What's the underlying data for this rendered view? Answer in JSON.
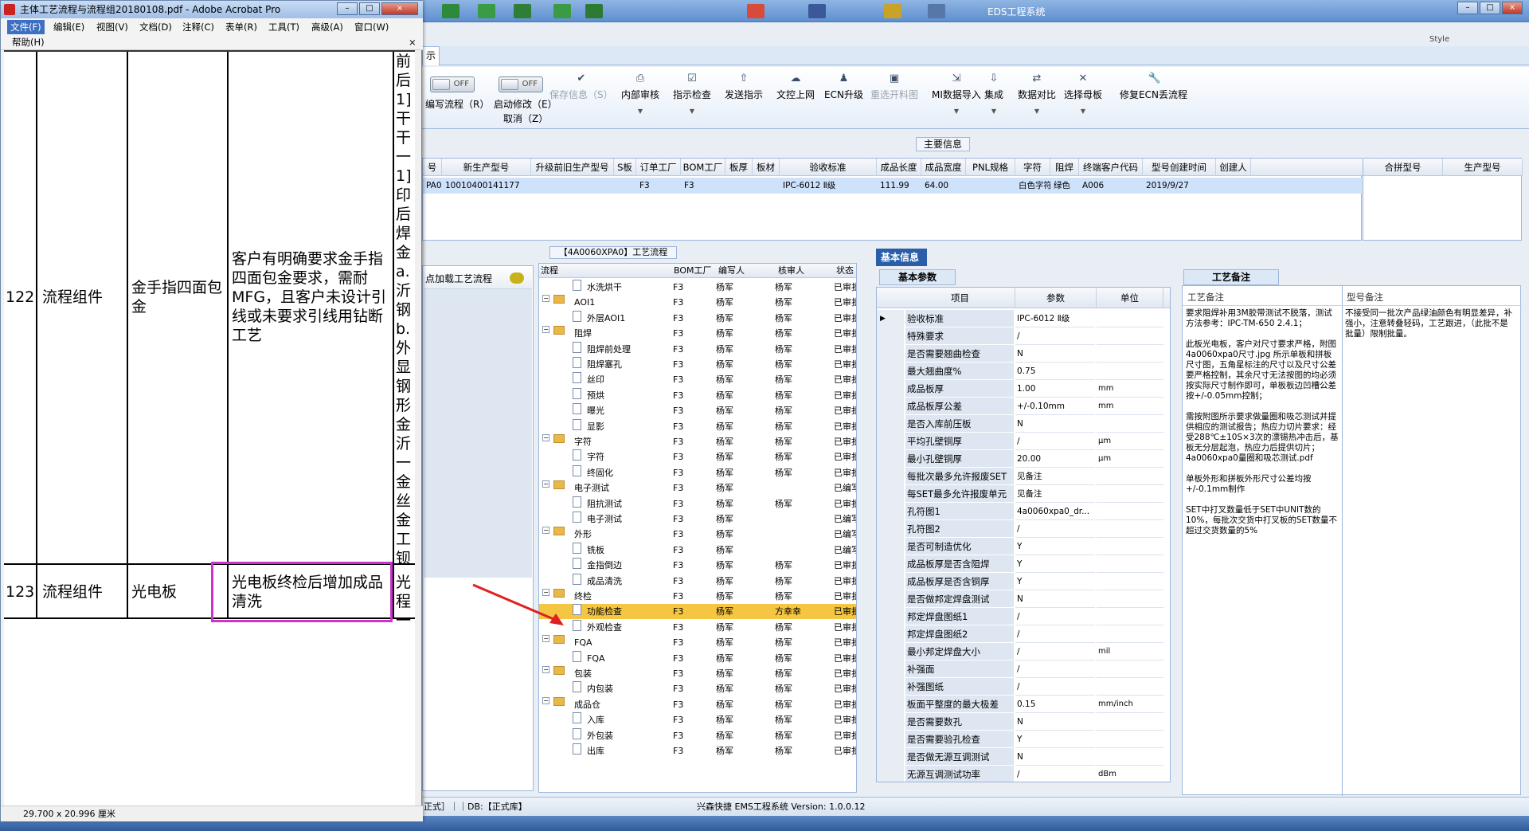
{
  "eds": {
    "title": "EDS工程系统",
    "style_label": "Style",
    "tab_label": "示",
    "toggles": [
      {
        "state": "OFF",
        "label": "编写流程（R）"
      },
      {
        "state": "OFF",
        "label": "启动修改（E）",
        "sub": "取消（Z）"
      }
    ],
    "ribbon": [
      {
        "label": "保存信息（S）",
        "icon": "check-icon",
        "disabled": true,
        "dropdown": false
      },
      {
        "label": "内部审核",
        "icon": "printer-icon",
        "disabled": false,
        "dropdown": true
      },
      {
        "label": "指示检查",
        "icon": "checkbox-icon",
        "disabled": false,
        "dropdown": true
      },
      {
        "label": "发送指示",
        "icon": "upload-icon",
        "disabled": false,
        "dropdown": false
      },
      {
        "label": "文控上网",
        "icon": "cloud-icon",
        "disabled": false,
        "dropdown": false
      },
      {
        "label": "ECN升级",
        "icon": "people-icon",
        "disabled": false,
        "dropdown": false
      },
      {
        "label": "重选开料图",
        "icon": "image-icon",
        "disabled": true,
        "dropdown": false
      },
      {
        "label": "MI数据导入",
        "icon": "import-icon",
        "disabled": false,
        "dropdown": true
      },
      {
        "label": "集成",
        "icon": "download-icon",
        "disabled": false,
        "dropdown": true
      },
      {
        "label": "数据对比",
        "icon": "compare-icon",
        "disabled": false,
        "dropdown": true
      },
      {
        "label": "选择母板",
        "icon": "shuffle-icon",
        "disabled": false,
        "dropdown": true
      },
      {
        "label": "修复ECN丢流程",
        "icon": "wrench-icon",
        "disabled": false,
        "dropdown": false
      }
    ],
    "main_info_label": "主要信息",
    "main_headers": [
      "号",
      "新生产型号",
      "升级前旧生产型号",
      "S板",
      "订单工厂",
      "BOM工厂",
      "板厚",
      "板材",
      "验收标准",
      "成品长度",
      "成品宽度",
      "PNL规格",
      "字符",
      "阻焊",
      "终端客户代码",
      "型号创建时间",
      "创建人"
    ],
    "main_row": [
      "PA0",
      "10010400141177",
      "",
      "",
      "F3",
      "F3",
      "",
      "",
      "IPC-6012 Ⅱ级",
      "111.99",
      "64.00",
      "",
      "白色字符",
      "绿色",
      "A006",
      "2019/9/27",
      ""
    ],
    "merge_headers": [
      "合拼型号",
      "生产型号"
    ],
    "proc_caption": "【4A0060XPA0】工艺流程",
    "load_btn": "点加载工艺流程",
    "tree_headers": [
      "流程",
      "BOM工厂",
      "编写人",
      "核审人",
      "状态"
    ],
    "tree": [
      {
        "lvl": 2,
        "type": "doc",
        "name": "水洗烘干",
        "bom": "F3",
        "w": "杨军",
        "r": "杨军",
        "s": "已审批"
      },
      {
        "lvl": 1,
        "type": "folder",
        "name": "AOI1",
        "bom": "F3",
        "w": "杨军",
        "r": "杨军",
        "s": "已审批"
      },
      {
        "lvl": 2,
        "type": "doc",
        "name": "外层AOI1",
        "bom": "F3",
        "w": "杨军",
        "r": "杨军",
        "s": "已审批"
      },
      {
        "lvl": 1,
        "type": "folder",
        "name": "阻焊",
        "bom": "F3",
        "w": "杨军",
        "r": "杨军",
        "s": "已审批"
      },
      {
        "lvl": 2,
        "type": "doc",
        "name": "阻焊前处理",
        "bom": "F3",
        "w": "杨军",
        "r": "杨军",
        "s": "已审批"
      },
      {
        "lvl": 2,
        "type": "doc",
        "name": "阻焊塞孔",
        "bom": "F3",
        "w": "杨军",
        "r": "杨军",
        "s": "已审批"
      },
      {
        "lvl": 2,
        "type": "doc",
        "name": "丝印",
        "bom": "F3",
        "w": "杨军",
        "r": "杨军",
        "s": "已审批"
      },
      {
        "lvl": 2,
        "type": "doc",
        "name": "预烘",
        "bom": "F3",
        "w": "杨军",
        "r": "杨军",
        "s": "已审批"
      },
      {
        "lvl": 2,
        "type": "doc",
        "name": "曝光",
        "bom": "F3",
        "w": "杨军",
        "r": "杨军",
        "s": "已审批"
      },
      {
        "lvl": 2,
        "type": "doc",
        "name": "显影",
        "bom": "F3",
        "w": "杨军",
        "r": "杨军",
        "s": "已审批"
      },
      {
        "lvl": 1,
        "type": "folder",
        "name": "字符",
        "bom": "F3",
        "w": "杨军",
        "r": "杨军",
        "s": "已审批"
      },
      {
        "lvl": 2,
        "type": "doc",
        "name": "字符",
        "bom": "F3",
        "w": "杨军",
        "r": "杨军",
        "s": "已审批"
      },
      {
        "lvl": 2,
        "type": "doc",
        "name": "终固化",
        "bom": "F3",
        "w": "杨军",
        "r": "杨军",
        "s": "已审批"
      },
      {
        "lvl": 1,
        "type": "folder",
        "name": "电子测试",
        "bom": "F3",
        "w": "杨军",
        "r": "",
        "s": "已编写"
      },
      {
        "lvl": 2,
        "type": "doc",
        "name": "阻抗测试",
        "bom": "F3",
        "w": "杨军",
        "r": "杨军",
        "s": "已审批"
      },
      {
        "lvl": 2,
        "type": "doc",
        "name": "电子测试",
        "bom": "F3",
        "w": "杨军",
        "r": "",
        "s": "已编写"
      },
      {
        "lvl": 1,
        "type": "folder",
        "name": "外形",
        "bom": "F3",
        "w": "杨军",
        "r": "",
        "s": "已编写"
      },
      {
        "lvl": 2,
        "type": "doc",
        "name": "铣板",
        "bom": "F3",
        "w": "杨军",
        "r": "",
        "s": "已编写"
      },
      {
        "lvl": 2,
        "type": "doc",
        "name": "金指倒边",
        "bom": "F3",
        "w": "杨军",
        "r": "杨军",
        "s": "已审批"
      },
      {
        "lvl": 2,
        "type": "doc",
        "name": "成品清洗",
        "bom": "F3",
        "w": "杨军",
        "r": "杨军",
        "s": "已审批"
      },
      {
        "lvl": 1,
        "type": "folder",
        "name": "终检",
        "bom": "F3",
        "w": "杨军",
        "r": "杨军",
        "s": "已审批"
      },
      {
        "lvl": 2,
        "type": "doc",
        "name": "功能检查",
        "bom": "F3",
        "w": "杨军",
        "r": "方幸幸",
        "s": "已审批",
        "sel": true
      },
      {
        "lvl": 2,
        "type": "doc",
        "name": "外观检查",
        "bom": "F3",
        "w": "杨军",
        "r": "杨军",
        "s": "已审批"
      },
      {
        "lvl": 1,
        "type": "folder",
        "name": "FQA",
        "bom": "F3",
        "w": "杨军",
        "r": "杨军",
        "s": "已审批"
      },
      {
        "lvl": 2,
        "type": "doc",
        "name": "FQA",
        "bom": "F3",
        "w": "杨军",
        "r": "杨军",
        "s": "已审批"
      },
      {
        "lvl": 1,
        "type": "folder",
        "name": "包装",
        "bom": "F3",
        "w": "杨军",
        "r": "杨军",
        "s": "已审批"
      },
      {
        "lvl": 2,
        "type": "doc",
        "name": "内包装",
        "bom": "F3",
        "w": "杨军",
        "r": "杨军",
        "s": "已审批"
      },
      {
        "lvl": 1,
        "type": "folder",
        "name": "成品仓",
        "bom": "F3",
        "w": "杨军",
        "r": "杨军",
        "s": "已审批"
      },
      {
        "lvl": 2,
        "type": "doc",
        "name": "入库",
        "bom": "F3",
        "w": "杨军",
        "r": "杨军",
        "s": "已审批"
      },
      {
        "lvl": 2,
        "type": "doc",
        "name": "外包装",
        "bom": "F3",
        "w": "杨军",
        "r": "杨军",
        "s": "已审批"
      },
      {
        "lvl": 2,
        "type": "doc",
        "name": "出库",
        "bom": "F3",
        "w": "杨军",
        "r": "杨军",
        "s": "已审批"
      }
    ],
    "basic_tab": "基本信息",
    "basic_subtab": "基本参数",
    "param_headers": [
      "项目",
      "参数",
      "单位"
    ],
    "params": [
      [
        "验收标准",
        "IPC-6012 Ⅱ级",
        ""
      ],
      [
        "特殊要求",
        "/",
        ""
      ],
      [
        "是否需要翘曲检查",
        "N",
        ""
      ],
      [
        "最大翘曲度%",
        "0.75",
        ""
      ],
      [
        "成品板厚",
        "1.00",
        "mm"
      ],
      [
        "成品板厚公差",
        "+/-0.10mm",
        "mm"
      ],
      [
        "是否入库前压板",
        "N",
        ""
      ],
      [
        "平均孔壁铜厚",
        "/",
        "μm"
      ],
      [
        "最小孔壁铜厚",
        "20.00",
        "μm"
      ],
      [
        "每批次最多允许报废SET",
        "见备注",
        ""
      ],
      [
        "每SET最多允许报废单元",
        "见备注",
        ""
      ],
      [
        "孔符图1",
        "4a0060xpa0_dr...",
        ""
      ],
      [
        "孔符图2",
        "/",
        ""
      ],
      [
        "是否可制造优化",
        "Y",
        ""
      ],
      [
        "成品板厚是否含阻焊",
        "Y",
        ""
      ],
      [
        "成品板厚是否含铜厚",
        "Y",
        ""
      ],
      [
        "是否做邦定焊盘测试",
        "N",
        ""
      ],
      [
        "邦定焊盘图纸1",
        "/",
        ""
      ],
      [
        "邦定焊盘图纸2",
        "/",
        ""
      ],
      [
        "最小邦定焊盘大小",
        "/",
        "mil"
      ],
      [
        "补强面",
        "/",
        ""
      ],
      [
        "补强图纸",
        "/",
        ""
      ],
      [
        "板面平整度的最大极差",
        "0.15",
        "mm/inch"
      ],
      [
        "是否需要数孔",
        "N",
        ""
      ],
      [
        "是否需要验孔检查",
        "Y",
        ""
      ],
      [
        "是否做无源互调测试",
        "N",
        ""
      ],
      [
        "无源互调测试功率",
        "/",
        "dBm"
      ]
    ],
    "remark_tab": "工艺备注",
    "remark_h1": "工艺备注",
    "remark_h2": "型号备注",
    "remark1": "要求阻焊补用3M胶带测试不脱落，测试方法参考：IPC-TM-650 2.4.1；\n\n此板光电板，客户对尺寸要求严格，附图4a0060xpa0尺寸.jpg 所示单板和拼板尺寸图，五角星标注的尺寸以及尺寸公差要严格控制，其余尺寸无法按图的均必须按实际尺寸制作即可，单板板边凹槽公差按+/-0.05mm控制；\n\n需按附图所示要求做量圈和吸芯测试并提供相应的测试报告；热应力切片要求：经受288℃±10S×3次的漂锡热冲击后，基板无分层起泡，热应力后提供切片；4a0060xpa0量圈和吸芯测试.pdf\n\n单板外形和拼板外形尺寸公差均按+/-0.1mm制作\n\nSET中打叉数量低于SET中UNIT数的10%，每批次交货中打叉板的SET数量不超过交货数量的5%",
    "remark2": "不接受同一批次产品绿油颜色有明显差异，补强小，注意转叠轻码，工艺跟进，（此批不是批量）限制批量。",
    "status_left": "正式］｜｜DB:【正式库】",
    "status_center": "兴森快捷 EMS工程系统 Version: 1.0.0.12"
  },
  "acro": {
    "title": "主体工艺流程与流程组20180108.pdf - Adobe Acrobat Pro",
    "menu": [
      "文件(F)",
      "编辑(E)",
      "视图(V)",
      "文档(D)",
      "注释(C)",
      "表单(R)",
      "工具(T)",
      "高级(A)",
      "窗口(W)",
      "帮助(H)"
    ],
    "rows": [
      {
        "num": "122",
        "c1": "流程组件",
        "c2": "金手指四面包金",
        "c3": "客户有明确要求金手指四面包金要求，需耐MFG，且客户未设计引线或未要求引线用钻断工艺"
      },
      {
        "num": "123",
        "c1": "流程组件",
        "c2": "光电板",
        "c3": "光电板终检后增加成品清洗"
      }
    ],
    "right_col_text": "前后1]干干一1]印后焊金a.沂钢b.外显钢形金沂一金丝金工钡",
    "right_col_text2": "光程一",
    "page_size": "29.700 x 20.996 厘米"
  },
  "colors": {
    "highlight_box": "#cc33cc",
    "arrow": "#e02020",
    "selected_row": "#f5c642"
  }
}
